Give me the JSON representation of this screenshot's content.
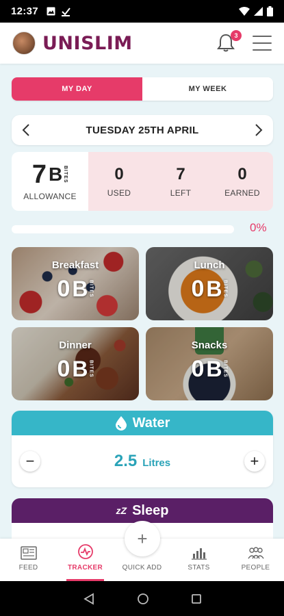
{
  "status_bar": {
    "time": "12:37"
  },
  "header": {
    "logo": "UNISLIM",
    "notification_count": "3"
  },
  "segment": {
    "my_day": "MY DAY",
    "my_week": "MY WEEK"
  },
  "date_nav": {
    "date": "TUESDAY 25TH APRIL"
  },
  "bites": {
    "allowance_value": "7",
    "b_letter": "B",
    "bites_word": "BITES",
    "allowance_label": "ALLOWANCE",
    "used_value": "0",
    "used_label": "USED",
    "left_value": "7",
    "left_label": "LEFT",
    "earned_value": "0",
    "earned_label": "EARNED"
  },
  "progress": {
    "percent_text": "0%",
    "fraction": 0
  },
  "meals": [
    {
      "title": "Breakfast",
      "value": "0",
      "b_letter": "B",
      "bites_word": "BITES"
    },
    {
      "title": "Lunch",
      "value": "0",
      "b_letter": "B",
      "bites_word": "BITES"
    },
    {
      "title": "Dinner",
      "value": "0",
      "b_letter": "B",
      "bites_word": "BITES"
    },
    {
      "title": "Snacks",
      "value": "0",
      "b_letter": "B",
      "bites_word": "BITES"
    }
  ],
  "water": {
    "title": "Water",
    "value": "2.5",
    "unit": "Litres",
    "minus": "−",
    "plus": "+"
  },
  "sleep": {
    "title": "Sleep",
    "zz": "zZ"
  },
  "bottom_nav": {
    "feed": "FEED",
    "tracker": "TRACKER",
    "quick_add": "QUICK ADD",
    "quick_add_symbol": "+",
    "stats": "STATS",
    "people": "PEOPLE"
  },
  "colors": {
    "accent": "#e63b69",
    "brand": "#7a1c55",
    "water": "#36b6c8",
    "sleep": "#5a1f66"
  }
}
